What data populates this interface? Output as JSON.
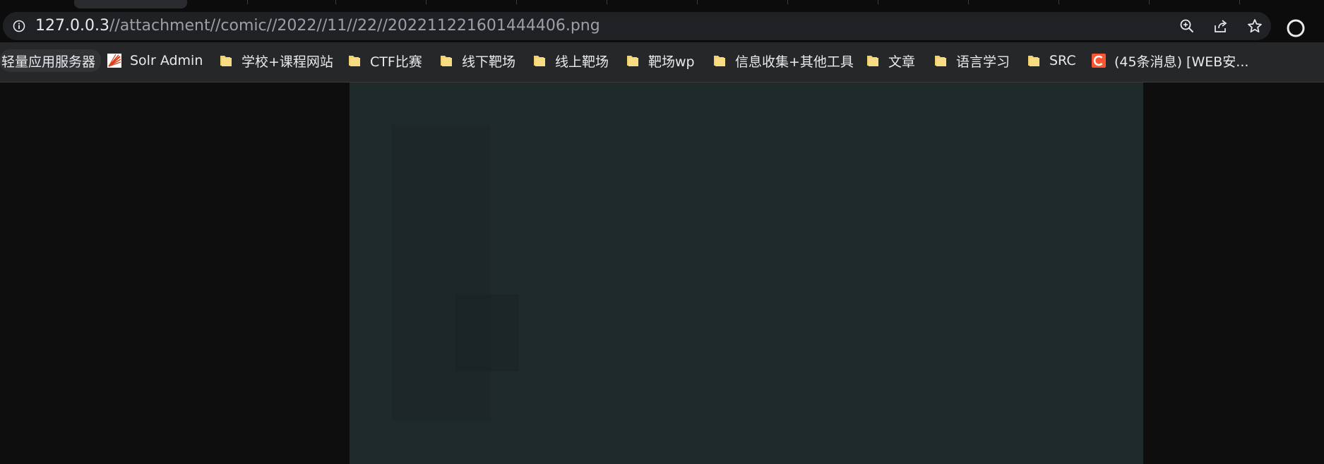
{
  "address_bar": {
    "host": "127.0.0.3",
    "path": "//attachment//comic//2022//11//22//202211221601444406.png"
  },
  "icons": {
    "site_info": "info-icon",
    "zoom": "zoom-in-icon",
    "share": "share-icon",
    "bookmark": "star-icon",
    "extension": "extension-icon"
  },
  "bookmarks": [
    {
      "label": "轻量应用服务器",
      "icon": "none"
    },
    {
      "label": "Solr Admin",
      "icon": "solr-logo-icon"
    },
    {
      "label": "学校+课程网站",
      "icon": "folder-icon"
    },
    {
      "label": "CTF比赛",
      "icon": "folder-icon"
    },
    {
      "label": "线下靶场",
      "icon": "folder-icon"
    },
    {
      "label": "线上靶场",
      "icon": "folder-icon"
    },
    {
      "label": "靶场wp",
      "icon": "folder-icon"
    },
    {
      "label": "信息收集+其他工具",
      "icon": "folder-icon"
    },
    {
      "label": "文章",
      "icon": "folder-icon"
    },
    {
      "label": "语言学习",
      "icon": "folder-icon"
    },
    {
      "label": "SRC",
      "icon": "folder-icon"
    },
    {
      "label": "(45条消息) [WEB安...",
      "icon": "csdn-logo-icon"
    }
  ],
  "colors": {
    "page_background": "#0e0e0e",
    "image_background": "#1f2a2b",
    "bookmark_bar": "#262729",
    "omnibox": "#202124",
    "folder": "#f2d06b"
  }
}
